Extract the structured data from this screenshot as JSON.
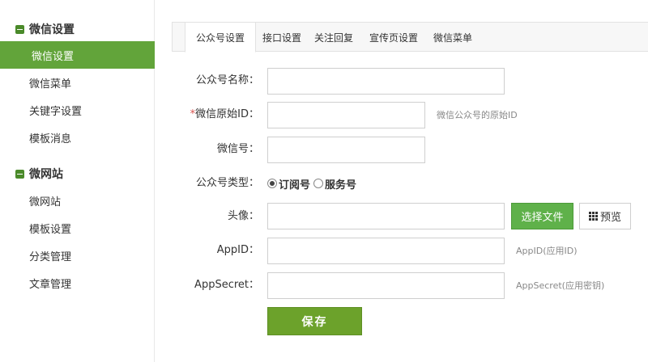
{
  "sidebar": {
    "groups": [
      {
        "title": "微信设置",
        "items": [
          "微信设置",
          "微信菜单",
          "关键字设置",
          "模板消息"
        ]
      },
      {
        "title": "微网站",
        "items": [
          "微网站",
          "模板设置",
          "分类管理",
          "文章管理"
        ]
      }
    ],
    "active_item": "微信设置"
  },
  "tabs": [
    "公众号设置",
    "接口设置",
    "关注回复",
    "宣传页设置",
    "微信菜单"
  ],
  "active_tab": "公众号设置",
  "form": {
    "name_label": "公众号名称：",
    "name_value": "",
    "original_id_required": "*",
    "original_id_label": "微信原始ID：",
    "original_id_value": "",
    "original_id_hint": "微信公众号的原始ID",
    "wechat_no_label": "微信号：",
    "wechat_no_value": "",
    "type_label": "公众号类型：",
    "type_options": [
      "订阅号",
      "服务号"
    ],
    "type_selected": "订阅号",
    "avatar_label": "头像：",
    "avatar_value": "",
    "choose_file_label": "选择文件",
    "preview_label": "预览",
    "appid_label": "AppID：",
    "appid_value": "",
    "appid_hint": "AppID(应用ID)",
    "appsecret_label": "AppSecret：",
    "appsecret_value": "",
    "appsecret_hint": "AppSecret(应用密钥)",
    "save_label": "保存"
  },
  "colors": {
    "accent": "#62a43a",
    "save": "#6ca22b",
    "file_button": "#5fb14a"
  }
}
